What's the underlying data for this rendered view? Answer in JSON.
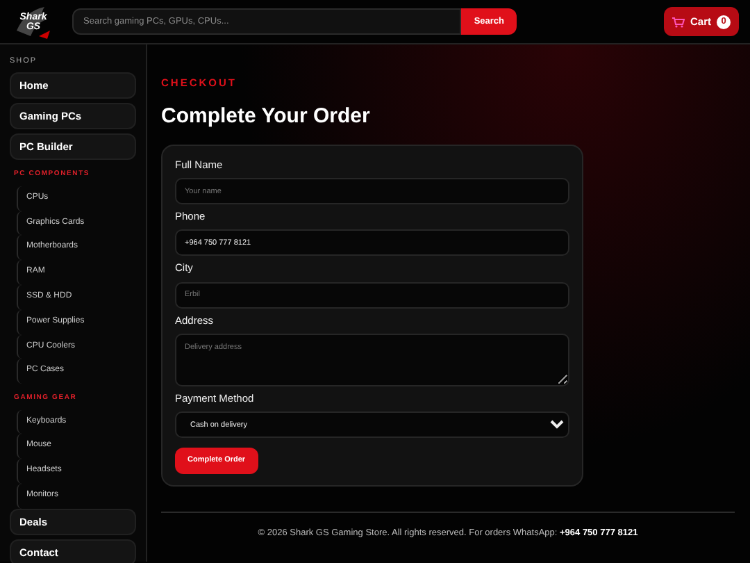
{
  "header": {
    "logo": {
      "line1": "Shark",
      "line2": "GS"
    },
    "search": {
      "placeholder": "Search gaming PCs, GPUs, CPUs..."
    },
    "search_button": "Search",
    "cart": {
      "label": "Cart",
      "count": "0"
    }
  },
  "sidebar": {
    "title": "SHOP",
    "items": [
      {
        "kind": "main",
        "label": "Home"
      },
      {
        "kind": "main",
        "label": "Gaming PCs"
      },
      {
        "kind": "main",
        "label": "PC Builder"
      },
      {
        "kind": "heading",
        "label": "PC COMPONENTS"
      },
      {
        "kind": "sub",
        "label": "CPUs"
      },
      {
        "kind": "sub",
        "label": "Graphics Cards"
      },
      {
        "kind": "sub",
        "label": "Motherboards"
      },
      {
        "kind": "sub",
        "label": "RAM"
      },
      {
        "kind": "sub",
        "label": "SSD & HDD"
      },
      {
        "kind": "sub",
        "label": "Power Supplies"
      },
      {
        "kind": "sub",
        "label": "CPU Coolers"
      },
      {
        "kind": "sub",
        "label": "PC Cases"
      },
      {
        "kind": "heading",
        "label": "GAMING GEAR"
      },
      {
        "kind": "sub",
        "label": "Keyboards"
      },
      {
        "kind": "sub",
        "label": "Mouse"
      },
      {
        "kind": "sub",
        "label": "Headsets"
      },
      {
        "kind": "sub",
        "label": "Monitors"
      },
      {
        "kind": "main",
        "label": "Deals"
      },
      {
        "kind": "main",
        "label": "Contact"
      }
    ]
  },
  "eyebrow": "CHECKOUT",
  "title": "Complete Your Order",
  "form": {
    "fields": [
      {
        "kind": "input",
        "label": "Full Name",
        "placeholder": "Your name"
      },
      {
        "kind": "input",
        "label": "Phone",
        "value": "+964 750 777 8121"
      },
      {
        "kind": "input",
        "label": "City",
        "placeholder": "Erbil"
      },
      {
        "kind": "textarea",
        "label": "Address",
        "placeholder": "Delivery address"
      },
      {
        "kind": "select",
        "label": "Payment Method",
        "value": "Cash on delivery"
      }
    ],
    "submit": "Complete Order"
  },
  "footer": {
    "text": "© 2026 Shark GS Gaming Store. All rights reserved. For orders WhatsApp:",
    "phone": "+964 750 777 8121"
  }
}
